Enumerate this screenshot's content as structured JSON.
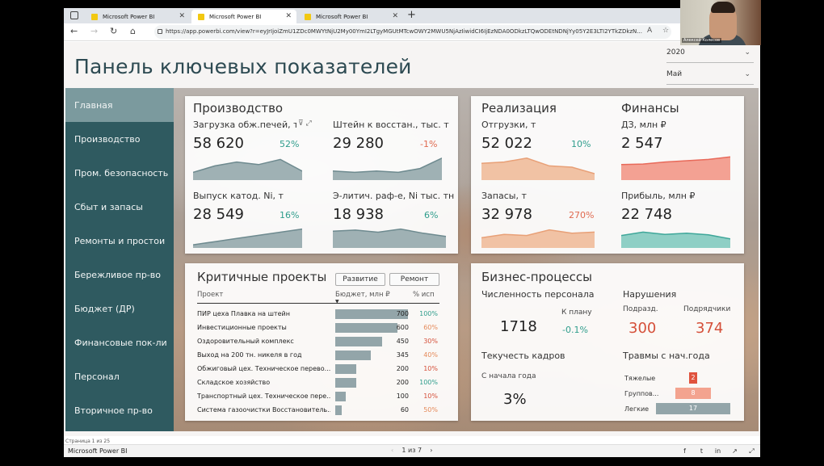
{
  "browser": {
    "tabs": [
      {
        "label": "Microsoft Power BI"
      },
      {
        "label": "Microsoft Power BI"
      },
      {
        "label": "Microsoft Power BI"
      }
    ],
    "url": "https://app.powerbi.com/view?r=eyJrIjoiZmU1ZDc0MWYtNjU2My00YmI2LTgyMGUtMTcwOWY2MWU5NjAzIiwidCI6IjEzNDA0ODkzLTQwODEtNDNjYy05Y2E3LTI2YTkZDkzN..."
  },
  "report": {
    "title": "Панель ключевых показателей",
    "slicers": [
      {
        "value": "2020"
      },
      {
        "value": "Май"
      }
    ]
  },
  "sidebar": {
    "items": [
      {
        "label": "Главная"
      },
      {
        "label": "Производство"
      },
      {
        "label": "Пром. безопасность"
      },
      {
        "label": "Сбыт и запасы"
      },
      {
        "label": "Ремонты и простои"
      },
      {
        "label": "Бережливое пр-во"
      },
      {
        "label": "Бюджет (ДР)"
      },
      {
        "label": "Финансовые пок-ли"
      },
      {
        "label": "Персонал"
      },
      {
        "label": "Вторичное пр-во"
      }
    ]
  },
  "production": {
    "title": "Производство",
    "kpis": [
      {
        "label": "Загрузка обж.печей, т",
        "value": "58 620",
        "pct": "52%",
        "spark": [
          0.3,
          0.55,
          0.7,
          0.6,
          0.8,
          0.35
        ]
      },
      {
        "label": "Штейн к восстан., тыс. т",
        "value": "29 280",
        "pct": "-1%",
        "spark": [
          0.35,
          0.3,
          0.35,
          0.3,
          0.45,
          0.85
        ]
      },
      {
        "label": "Выпуск катод. Ni, т",
        "value": "28 549",
        "pct": "16%",
        "spark": [
          0.15,
          0.3,
          0.45,
          0.6,
          0.75,
          0.9
        ]
      },
      {
        "label": "Э-литич. раф-е, Ni тыс. тн",
        "value": "18 938",
        "pct": "6%",
        "spark": [
          0.8,
          0.85,
          0.75,
          0.9,
          0.7,
          0.55
        ]
      }
    ]
  },
  "sales": {
    "title": "Реализация",
    "kpis": [
      {
        "label": "Отгрузки, т",
        "value": "52 022",
        "pct": "10%",
        "spark": [
          0.65,
          0.7,
          0.85,
          0.55,
          0.5,
          0.25
        ]
      },
      {
        "label": "Запасы, т",
        "value": "32 978",
        "pct": "270%",
        "spark": [
          0.45,
          0.6,
          0.55,
          0.8,
          0.65,
          0.7
        ]
      }
    ]
  },
  "finance": {
    "title": "Финансы",
    "kpis": [
      {
        "label": "ДЗ, млн ₽",
        "value": "2 547",
        "spark": [
          0.6,
          0.62,
          0.7,
          0.75,
          0.8,
          0.9
        ]
      },
      {
        "label": "Прибыль, млн ₽",
        "value": "22 748",
        "spark": [
          0.55,
          0.7,
          0.6,
          0.65,
          0.58,
          0.4
        ]
      }
    ]
  },
  "projects": {
    "title": "Критичные проекты",
    "buttons": [
      "Развитие",
      "Ремонт"
    ],
    "headers": {
      "project": "Проект",
      "budget": "Бюджет, млн ₽",
      "pct": "% исп"
    },
    "rows": [
      {
        "name": "ПИР цеха Плавка на штейн",
        "budget": 700,
        "pct": "100%",
        "pct_color": "#2f9d8c"
      },
      {
        "name": "Инвестиционные проекты",
        "budget": 600,
        "pct": "60%",
        "pct_color": "#e58a5a"
      },
      {
        "name": "Оздоровительный комплекс",
        "budget": 450,
        "pct": "30%",
        "pct_color": "#d5503a"
      },
      {
        "name": "Выход на 200 тн. никеля в год",
        "budget": 345,
        "pct": "40%",
        "pct_color": "#e58a5a"
      },
      {
        "name": "Обжиговый цех. Техническое перево...",
        "budget": 200,
        "pct": "10%",
        "pct_color": "#d5503a"
      },
      {
        "name": "Складское хозяйство",
        "budget": 200,
        "pct": "100%",
        "pct_color": "#2f9d8c"
      },
      {
        "name": "Транспортный цех. Техническое пере...",
        "budget": 100,
        "pct": "10%",
        "pct_color": "#d5503a"
      },
      {
        "name": "Система газоочистки Восстановитель...",
        "budget": 60,
        "pct": "50%",
        "pct_color": "#e58a5a"
      }
    ]
  },
  "business": {
    "title": "Бизнес-процессы",
    "headcount": {
      "label": "Численность персонала",
      "value": "1718",
      "plan_label": "К плану",
      "plan_value": "-0.1%"
    },
    "violations": {
      "label": "Нарушения",
      "sub1_label": "Подразд.",
      "sub1_value": "300",
      "sub2_label": "Подрядчики",
      "sub2_value": "374"
    },
    "turnover": {
      "label": "Текучесть кадров",
      "sub_label": "С начала года",
      "value": "3%"
    },
    "injuries": {
      "label": "Травмы с нач.года",
      "rows": [
        {
          "label": "Тяжелые",
          "value": 2,
          "color": "#e0533e"
        },
        {
          "label": "Группов...",
          "value": 8,
          "color": "#f3a38f"
        },
        {
          "label": "Легкие",
          "value": 17,
          "color": "#93a5a9"
        }
      ]
    }
  },
  "footer": {
    "page_indicator": "Страница 1 из 25",
    "brand": "Microsoft Power BI",
    "pager": "1 из 7"
  },
  "webcam": {
    "name": "Алексей Колесов"
  }
}
